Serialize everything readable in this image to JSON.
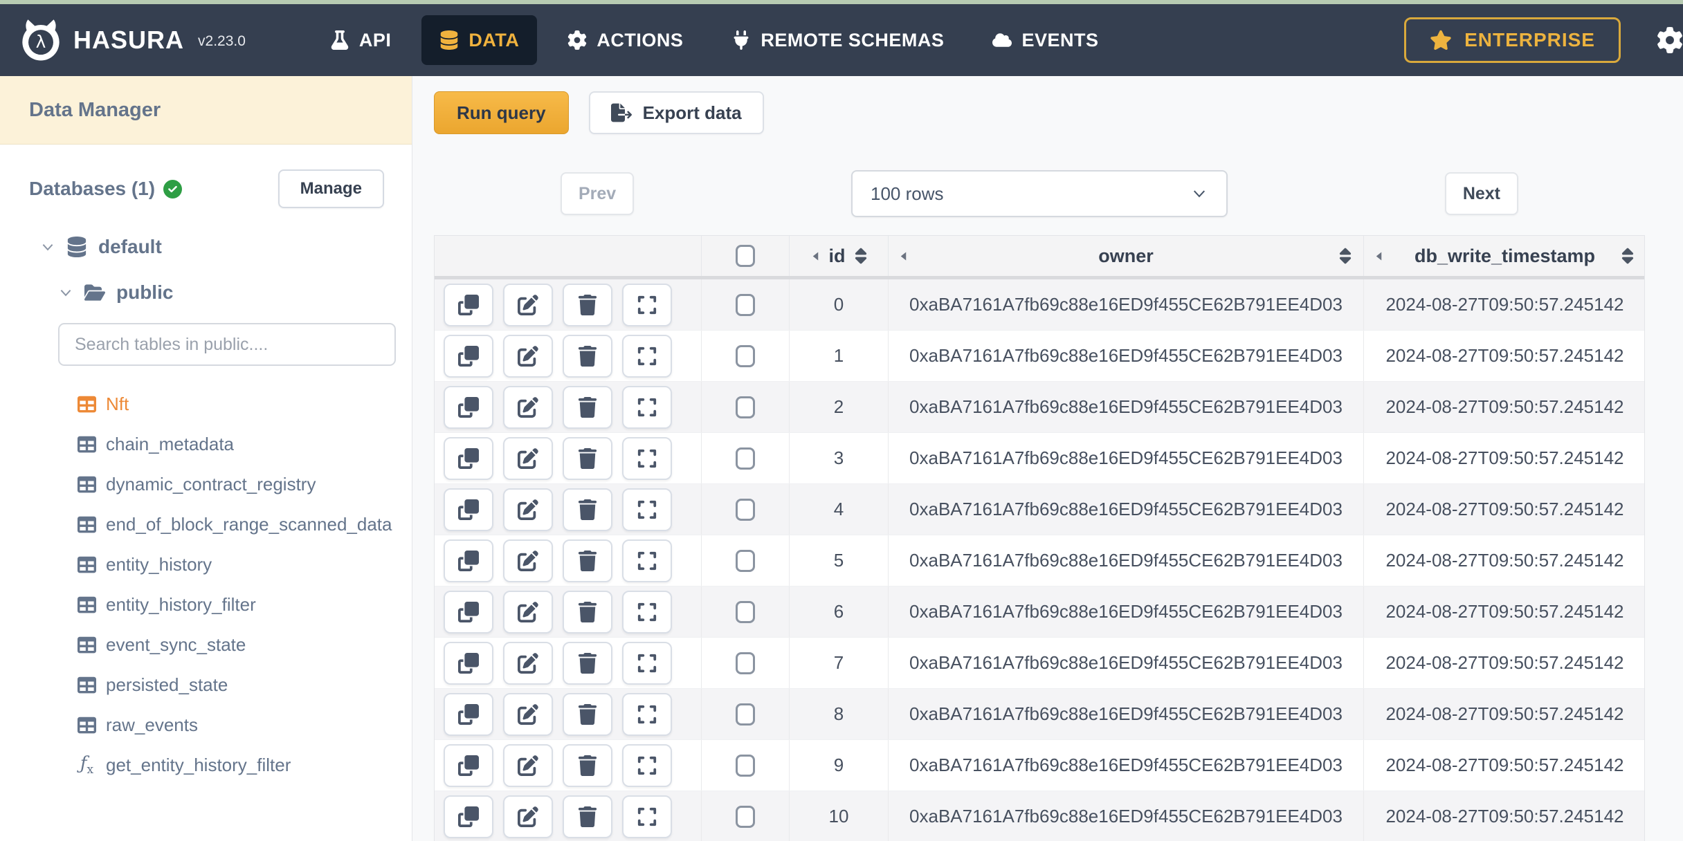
{
  "navbar": {
    "brand": "HASURA",
    "version": "v2.23.0",
    "api": "API",
    "data": "DATA",
    "actions": "ACTIONS",
    "remote_schemas": "REMOTE SCHEMAS",
    "events": "EVENTS",
    "enterprise": "ENTERPRISE"
  },
  "sidebar": {
    "title": "Data Manager",
    "databases_label": "Databases (1)",
    "manage_label": "Manage",
    "database_name": "default",
    "schema_name": "public",
    "search_placeholder": "Search tables in public....",
    "active_table": "Nft",
    "tables": [
      "chain_metadata",
      "dynamic_contract_registry",
      "end_of_block_range_scanned_data",
      "entity_history",
      "entity_history_filter",
      "event_sync_state",
      "persisted_state",
      "raw_events"
    ],
    "function_name": "get_entity_history_filter"
  },
  "toolbar": {
    "run_query": "Run query",
    "export_data": "Export data"
  },
  "pagination": {
    "prev": "Prev",
    "page_size": "100 rows",
    "next": "Next"
  },
  "table": {
    "columns": {
      "id": "id",
      "owner": "owner",
      "timestamp": "db_write_timestamp"
    },
    "rows": [
      {
        "id": "0",
        "owner": "0xaBA7161A7fb69c88e16ED9f455CE62B791EE4D03",
        "timestamp": "2024-08-27T09:50:57.245142"
      },
      {
        "id": "1",
        "owner": "0xaBA7161A7fb69c88e16ED9f455CE62B791EE4D03",
        "timestamp": "2024-08-27T09:50:57.245142"
      },
      {
        "id": "2",
        "owner": "0xaBA7161A7fb69c88e16ED9f455CE62B791EE4D03",
        "timestamp": "2024-08-27T09:50:57.245142"
      },
      {
        "id": "3",
        "owner": "0xaBA7161A7fb69c88e16ED9f455CE62B791EE4D03",
        "timestamp": "2024-08-27T09:50:57.245142"
      },
      {
        "id": "4",
        "owner": "0xaBA7161A7fb69c88e16ED9f455CE62B791EE4D03",
        "timestamp": "2024-08-27T09:50:57.245142"
      },
      {
        "id": "5",
        "owner": "0xaBA7161A7fb69c88e16ED9f455CE62B791EE4D03",
        "timestamp": "2024-08-27T09:50:57.245142"
      },
      {
        "id": "6",
        "owner": "0xaBA7161A7fb69c88e16ED9f455CE62B791EE4D03",
        "timestamp": "2024-08-27T09:50:57.245142"
      },
      {
        "id": "7",
        "owner": "0xaBA7161A7fb69c88e16ED9f455CE62B791EE4D03",
        "timestamp": "2024-08-27T09:50:57.245142"
      },
      {
        "id": "8",
        "owner": "0xaBA7161A7fb69c88e16ED9f455CE62B791EE4D03",
        "timestamp": "2024-08-27T09:50:57.245142"
      },
      {
        "id": "9",
        "owner": "0xaBA7161A7fb69c88e16ED9f455CE62B791EE4D03",
        "timestamp": "2024-08-27T09:50:57.245142"
      },
      {
        "id": "10",
        "owner": "0xaBA7161A7fb69c88e16ED9f455CE62B791EE4D03",
        "timestamp": "2024-08-27T09:50:57.245142"
      }
    ]
  },
  "colors": {
    "navbar_bg": "#353f50",
    "active_tab_bg": "#141e2b",
    "accent_gold": "#f0b23e",
    "active_table_orange": "#ed8936",
    "sidebar_header_cream": "#fcf2d9",
    "success_green": "#2e9e44",
    "run_query_amber": "#eba62f"
  }
}
